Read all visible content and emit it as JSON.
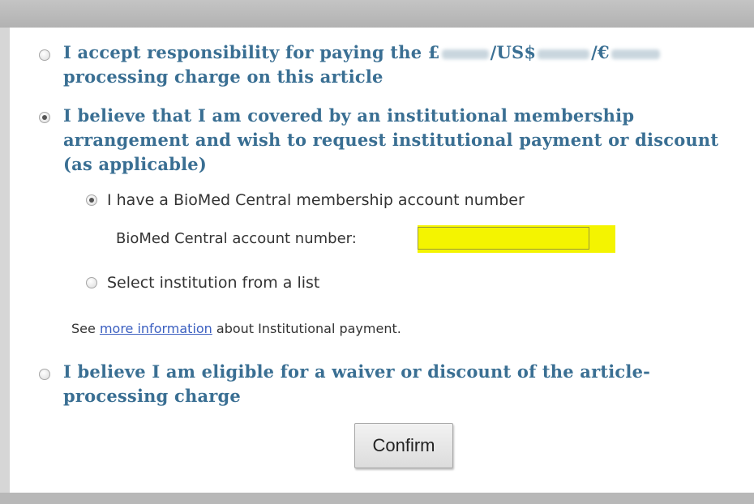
{
  "options": {
    "accept": {
      "prefix": "I accept responsibility for paying the £",
      "sep1": "/US$",
      "sep2": "/€",
      "line2": "processing charge on this article",
      "selected": false
    },
    "institutional": {
      "line1": "I believe that I am covered by an institutional membership",
      "line2": "arrangement and wish to request institutional payment or discount",
      "line3": "(as applicable)",
      "selected": true,
      "sub_options": {
        "membership": {
          "label": "I have a BioMed Central membership account number",
          "selected": true
        },
        "account_label": "BioMed Central account number:",
        "account_value": "",
        "select_list": {
          "label": "Select institution from a list",
          "selected": false
        }
      },
      "info_prefix": "See",
      "info_link": "more information",
      "info_suffix": "about Institutional payment."
    },
    "waiver": {
      "line1": "I believe I am eligible for a waiver or discount of the article-",
      "line2": "processing charge",
      "selected": false
    }
  },
  "confirm_label": "Confirm",
  "colors": {
    "option_text": "#3a6f93",
    "highlight": "#f4f400",
    "link": "#3b5fc0"
  }
}
